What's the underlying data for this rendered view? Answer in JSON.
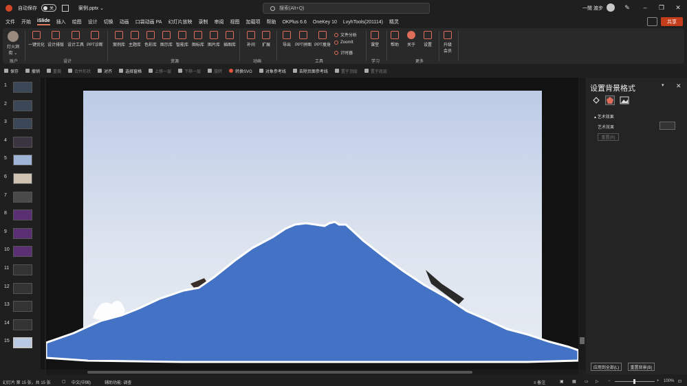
{
  "titlebar": {
    "autosave_label": "自动保存",
    "autosave_state": "关",
    "filename": "案例.pptx",
    "filename_caret": "⌄",
    "search_placeholder": "搜索(Alt+Q)",
    "user_name": "一閒 渡步"
  },
  "menu": {
    "tabs": [
      "文件",
      "开始",
      "iSlide",
      "插入",
      "绘图",
      "设计",
      "切换",
      "动画",
      "口袋动画 PA",
      "幻灯片放映",
      "录制",
      "审阅",
      "视图",
      "加载项",
      "帮助",
      "OKPlus 6.6",
      "OneKey 10",
      "LvyhTools(201114)",
      "精灵"
    ],
    "active_tab": "iSlide",
    "share_label": "共享"
  },
  "ribbon": {
    "account": {
      "label": "灯火涧",
      "sublabel": "街 ⌄",
      "group": "账户"
    },
    "design_buttons": [
      "一键优化",
      "设计排版",
      "设计工具",
      "PPT诊断"
    ],
    "design_group": "设计",
    "resource_buttons": [
      "案例库",
      "主题库",
      "色彩库",
      "图示库",
      "智能库",
      "图标库",
      "图片库",
      "插图库"
    ],
    "resource_group": "资源",
    "anim_buttons": [
      "补间",
      "扩展"
    ],
    "anim_group": "动画",
    "tool_buttons": [
      "导出",
      "PPT拼图",
      "PPT瘦身"
    ],
    "tool_small": [
      "文件分析",
      "ZoomIt",
      "计时器"
    ],
    "tool_group": "工具",
    "learn_buttons": [
      "课堂"
    ],
    "learn_group": "学习",
    "more_buttons": [
      "帮助",
      "关于",
      "设置"
    ],
    "more_group": "更多",
    "upgrade": {
      "label": "升级",
      "sublabel": "会员"
    }
  },
  "quick_toolbar": [
    {
      "label": "保存",
      "enabled": true
    },
    {
      "label": "撤销",
      "enabled": true
    },
    {
      "label": "重做",
      "enabled": false
    },
    {
      "label": "合并形状",
      "enabled": false
    },
    {
      "label": "对齐",
      "enabled": true
    },
    {
      "label": "选择窗格",
      "enabled": true
    },
    {
      "label": "上移一层",
      "enabled": false
    },
    {
      "label": "下移一层",
      "enabled": false
    },
    {
      "label": "旋转",
      "enabled": false
    },
    {
      "label": "转换SVG",
      "enabled": true
    },
    {
      "label": "对象参考线",
      "enabled": true
    },
    {
      "label": "去除页面参考线",
      "enabled": true
    },
    {
      "label": "置于顶层",
      "enabled": false
    },
    {
      "label": "置于底层",
      "enabled": false
    }
  ],
  "slides": {
    "numbers": [
      "1",
      "2",
      "3",
      "4",
      "5",
      "6",
      "7",
      "8",
      "9",
      "10",
      "11",
      "12",
      "13",
      "14",
      "15"
    ],
    "thumb_colors": [
      "#3b4656",
      "#3b4656",
      "#3b4656",
      "#3a3340",
      "#9fb4d6",
      "#cfc3b4",
      "#4a4a4a",
      "#5b2f73",
      "#5b2f73",
      "#5b2f73",
      "#333333",
      "#333333",
      "#333333",
      "#333333",
      "#b9c9e4"
    ],
    "selected": 15
  },
  "slide": {
    "mountain_color": "#4472c4",
    "sky_color": "#c9d5ea"
  },
  "pane": {
    "title": "设置背景格式",
    "section": "艺术效果",
    "effect_label": "艺术效果",
    "reset_label": "重置(R)",
    "apply_all": "应用到全部(L)",
    "reset_bg": "重置背景(B)"
  },
  "status": {
    "slide_info": "幻灯片 第 15 张，共 15 张",
    "language": "中文(中国)",
    "accessibility": "辅助功能: 调查",
    "notes": "备注",
    "zoom": "100%"
  }
}
